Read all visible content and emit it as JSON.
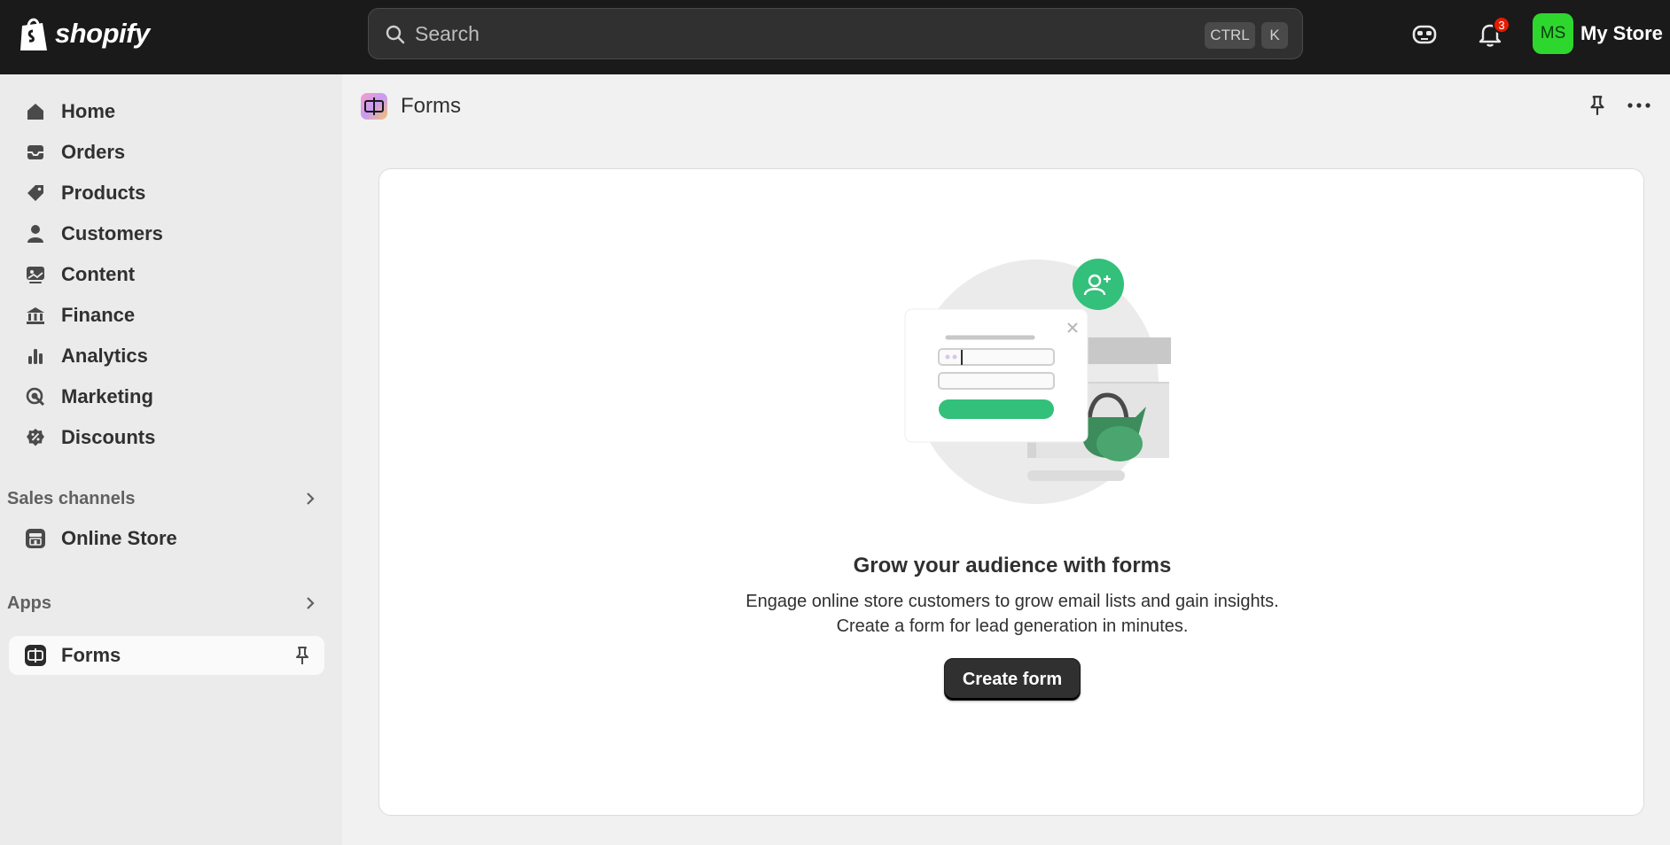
{
  "brand": {
    "name": "shopify"
  },
  "search": {
    "placeholder": "Search",
    "shortcut_ctrl": "CTRL",
    "shortcut_key": "K"
  },
  "notifications": {
    "count": "3"
  },
  "store": {
    "initials": "MS",
    "name": "My Store",
    "avatar_color": "#2ed72e"
  },
  "sidebar": {
    "items": [
      {
        "label": "Home",
        "icon": "home-icon"
      },
      {
        "label": "Orders",
        "icon": "inbox-icon"
      },
      {
        "label": "Products",
        "icon": "tag-icon"
      },
      {
        "label": "Customers",
        "icon": "person-icon"
      },
      {
        "label": "Content",
        "icon": "image-icon"
      },
      {
        "label": "Finance",
        "icon": "bank-icon"
      },
      {
        "label": "Analytics",
        "icon": "bar-chart-icon"
      },
      {
        "label": "Marketing",
        "icon": "target-icon"
      },
      {
        "label": "Discounts",
        "icon": "discount-icon"
      }
    ],
    "sales_channels": {
      "label": "Sales channels",
      "items": [
        {
          "label": "Online Store",
          "icon": "store-icon"
        }
      ]
    },
    "apps": {
      "label": "Apps",
      "items": [
        {
          "label": "Forms",
          "icon": "forms-icon"
        }
      ]
    }
  },
  "page": {
    "title": "Forms"
  },
  "empty_state": {
    "title": "Grow your audience with forms",
    "description_line1": "Engage online store customers to grow email lists and gain insights.",
    "description_line2": "Create a form for lead generation in minutes.",
    "button_label": "Create form"
  }
}
